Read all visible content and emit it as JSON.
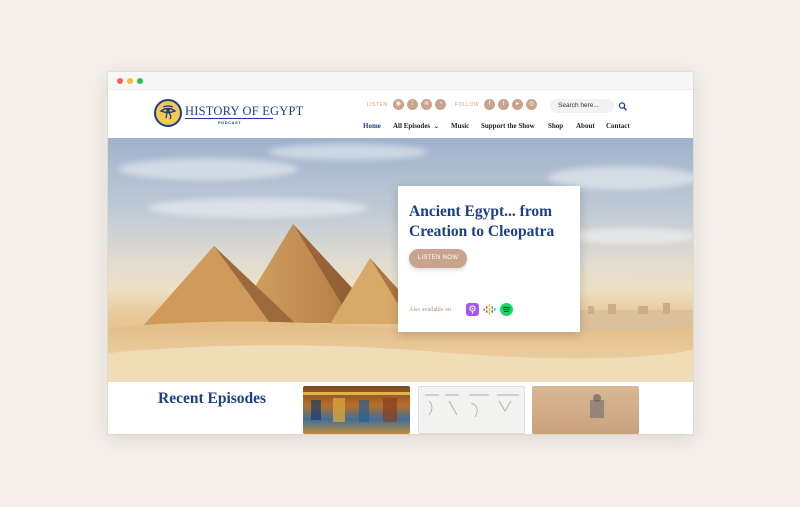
{
  "header": {
    "logo_title": "HISTORY OF EGYPT",
    "logo_subtitle": "PODCAST",
    "listen_label": "LISTEN",
    "follow_label": "FOLLOW",
    "search_placeholder": "Search here...",
    "listen_icons": [
      "apple-podcasts-icon",
      "google-podcasts-icon",
      "spotify-icon",
      "rss-icon"
    ],
    "follow_icons": [
      "facebook-icon",
      "twitter-icon",
      "youtube-icon",
      "instagram-icon"
    ]
  },
  "nav": {
    "items": [
      "Home",
      "All Episodes",
      "Music",
      "Support the Show",
      "Shop",
      "About",
      "Contact"
    ],
    "active": "Home"
  },
  "hero": {
    "title": "Ancient Egypt... from Creation to Cleopatra",
    "button_label": "LISTEN NOW",
    "available_label": "Also available on",
    "platforms": [
      "apple-podcasts-icon",
      "google-podcasts-icon",
      "spotify-icon"
    ]
  },
  "recent": {
    "title": "Recent Episodes"
  },
  "colors": {
    "brand_blue": "#1b3f8a",
    "accent_tan": "#c8a48c",
    "background": "#f4efeb"
  }
}
